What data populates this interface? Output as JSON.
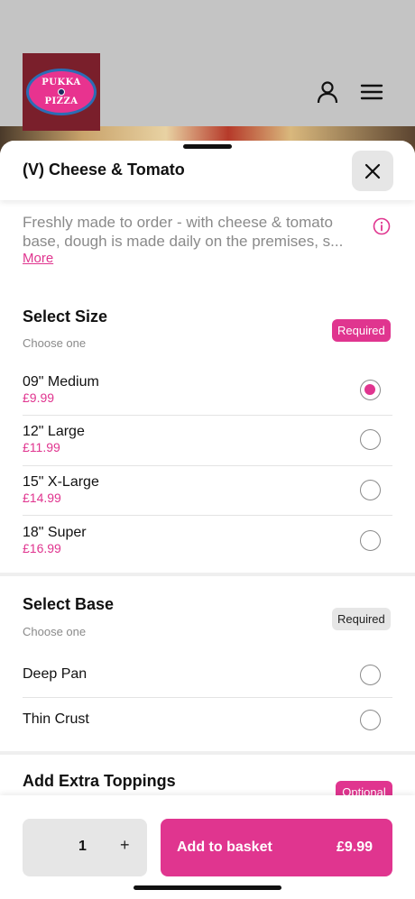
{
  "header": {
    "logo_text_top": "PUKKA",
    "logo_text_bottom": "PIZZA",
    "account_icon": "account-icon",
    "menu_icon": "hamburger-menu-icon"
  },
  "item": {
    "title": "(V) Cheese & Tomato",
    "description_line1": "Freshly made to order - with cheese & tomato",
    "description_line2": "base, dough is made daily on the premises, s...",
    "more_label": "More"
  },
  "size_section": {
    "title": "Select Size",
    "subtitle": "Choose one",
    "badge": "Required",
    "options": [
      {
        "name": "09\" Medium",
        "price": "£9.99",
        "selected": true
      },
      {
        "name": "12\" Large",
        "price": "£11.99",
        "selected": false
      },
      {
        "name": "15\" X-Large",
        "price": "£14.99",
        "selected": false
      },
      {
        "name": "18\" Super",
        "price": "£16.99",
        "selected": false
      }
    ]
  },
  "base_section": {
    "title": "Select Base",
    "subtitle": "Choose one",
    "badge": "Required",
    "options": [
      {
        "name": "Deep Pan",
        "selected": false
      },
      {
        "name": "Thin Crust",
        "selected": false
      }
    ]
  },
  "toppings_section": {
    "title": "Add Extra Toppings",
    "badge": "Optional"
  },
  "footer": {
    "quantity": "1",
    "plus": "+",
    "add_label": "Add to basket",
    "add_price": "£9.99"
  },
  "colors": {
    "accent": "#e0358f",
    "logo_bg": "#7a1f2b"
  }
}
